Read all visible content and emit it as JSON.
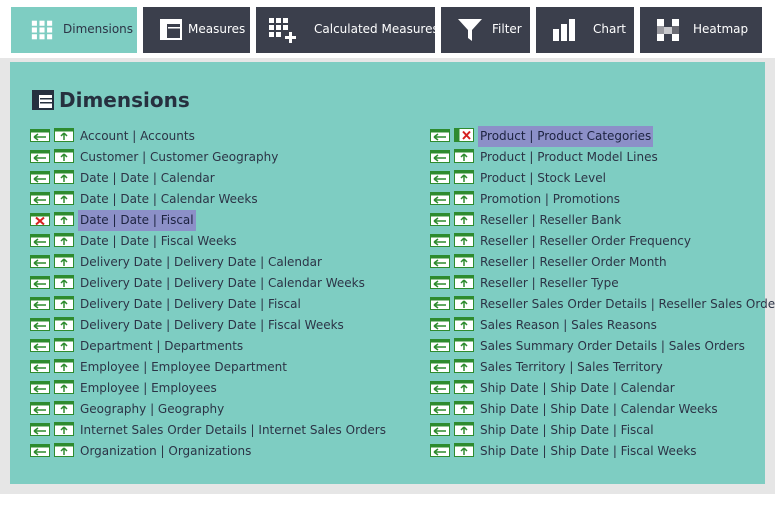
{
  "tabs": [
    {
      "label": "Dimensions",
      "icon": "grid-icon",
      "active": true
    },
    {
      "label": "Measures",
      "icon": "table-icon",
      "active": false
    },
    {
      "label": "Calculated Measures",
      "icon": "grid-plus-icon",
      "active": false
    },
    {
      "label": "Filter",
      "icon": "funnel-icon",
      "active": false
    },
    {
      "label": "Chart",
      "icon": "bar-chart-icon",
      "active": false
    },
    {
      "label": "Heatmap",
      "icon": "heatmap-icon",
      "active": false
    }
  ],
  "panel": {
    "title": "Dimensions",
    "title_icon": "dimensions-icon"
  },
  "dimensions_left": [
    {
      "label": "Account | Accounts",
      "selected": false
    },
    {
      "label": "Customer | Customer Geography",
      "selected": false
    },
    {
      "label": "Date | Date | Calendar",
      "selected": false
    },
    {
      "label": "Date | Date | Calendar Weeks",
      "selected": false
    },
    {
      "label": "Date | Date | Fiscal",
      "selected": true
    },
    {
      "label": "Date | Date | Fiscal Weeks",
      "selected": false
    },
    {
      "label": "Delivery Date | Delivery Date | Calendar",
      "selected": false
    },
    {
      "label": "Delivery Date | Delivery Date | Calendar Weeks",
      "selected": false
    },
    {
      "label": "Delivery Date | Delivery Date | Fiscal",
      "selected": false
    },
    {
      "label": "Delivery Date | Delivery Date | Fiscal Weeks",
      "selected": false
    },
    {
      "label": "Department | Departments",
      "selected": false
    },
    {
      "label": "Employee | Employee Department",
      "selected": false
    },
    {
      "label": "Employee | Employees",
      "selected": false
    },
    {
      "label": "Geography | Geography",
      "selected": false
    },
    {
      "label": "Internet Sales Order Details | Internet Sales Orders",
      "selected": false
    },
    {
      "label": "Organization | Organizations",
      "selected": false
    }
  ],
  "dimensions_right": [
    {
      "label": "Product | Product Categories",
      "selected": true
    },
    {
      "label": "Product | Product Model Lines",
      "selected": false
    },
    {
      "label": "Product | Stock Level",
      "selected": false
    },
    {
      "label": "Promotion | Promotions",
      "selected": false
    },
    {
      "label": "Reseller | Reseller Bank",
      "selected": false
    },
    {
      "label": "Reseller | Reseller Order Frequency",
      "selected": false
    },
    {
      "label": "Reseller | Reseller Order Month",
      "selected": false
    },
    {
      "label": "Reseller | Reseller Type",
      "selected": false
    },
    {
      "label": "Reseller Sales Order Details | Reseller Sales Orders",
      "selected": false
    },
    {
      "label": "Sales Reason | Sales Reasons",
      "selected": false
    },
    {
      "label": "Sales Summary Order Details | Sales Orders",
      "selected": false
    },
    {
      "label": "Sales Territory | Sales Territory",
      "selected": false
    },
    {
      "label": "Ship Date | Ship Date | Calendar",
      "selected": false
    },
    {
      "label": "Ship Date | Ship Date | Calendar Weeks",
      "selected": false
    },
    {
      "label": "Ship Date | Ship Date | Fiscal",
      "selected": false
    },
    {
      "label": "Ship Date | Ship Date | Fiscal Weeks",
      "selected": false
    }
  ],
  "colors": {
    "tab_bg": "#3b3f4c",
    "tab_active_bg": "#7ecdc2",
    "panel_bg": "#7ecdc2",
    "selected_bg": "#8c90c8",
    "icon_green": "#2e8b2e",
    "icon_red": "#d62020"
  }
}
